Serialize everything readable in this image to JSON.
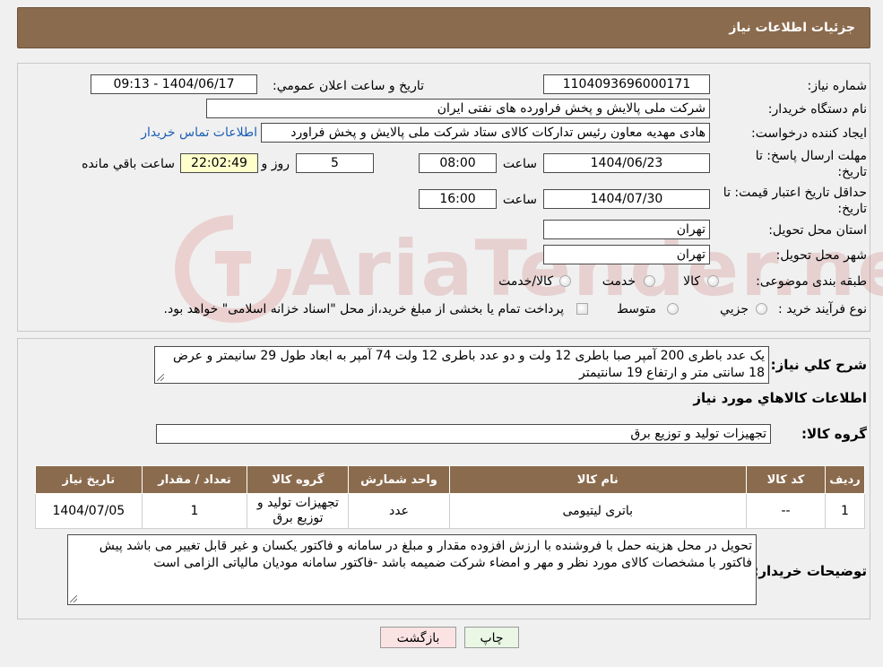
{
  "header": {
    "title": "جزئیات اطلاعات نیاز"
  },
  "form": {
    "need_number_label": "شماره نیاز:",
    "need_number": "1104093696000171",
    "announce_label": "تاریخ و ساعت اعلان عمومي:",
    "announce_value": "1404/06/17 - 09:13",
    "buyer_org_label": "نام دستگاه خریدار:",
    "buyer_org": "شرکت ملی پالایش و پخش فراورده های نفتی ایران",
    "creator_label": "ایجاد کننده درخواست:",
    "creator": "هادی مهدیه معاون رئیس تدارکات کالای ستاد شرکت ملی پالایش و پخش فراورد",
    "contact_link": "اطلاعات تماس خریدار",
    "deadline_label_1": "مهلت ارسال پاسخ: تا",
    "deadline_label_2": "تاریخ:",
    "deadline_date": "1404/06/23",
    "time_label": "ساعت",
    "deadline_time": "08:00",
    "days_value": "5",
    "days_label": "روز و",
    "remaining_time": "22:02:49",
    "remaining_label": "ساعت باقي مانده",
    "validity_label_1": "حداقل تاریخ اعتبار قیمت: تا",
    "validity_label_2": "تاریخ:",
    "validity_date": "1404/07/30",
    "validity_time": "16:00",
    "province_label": "استان محل تحویل:",
    "province": "تهران",
    "city_label": "شهر محل تحویل:",
    "city": "تهران",
    "category_label": "طبقه بندی موضوعی:",
    "category_options": [
      "کالا",
      "خدمت",
      "کالا/خدمت"
    ],
    "process_label": "نوع فرآیند خرید :",
    "process_options": [
      "جزیي",
      "متوسط"
    ],
    "process_note": "پرداخت تمام یا بخشی از مبلغ خرید،از محل \"اسناد خزانه اسلامی\" خواهد بود."
  },
  "summary": {
    "label": "شرح کلي نیاز:",
    "text": "یک عدد باطری 200 آمپر صبا باطری 12 ولت و دو عدد باطری 12 ولت 74 آمپر به ابعاد طول 29 سانیمتر و عرض 18 سانتی متر و ارتفاع 19 سانتیمتر"
  },
  "goods": {
    "section_title": "اطلاعات کالاهاي مورد نیاز",
    "group_label": "گروه کالا:",
    "group_value": "تجهیزات تولید و توزیع برق"
  },
  "table": {
    "headers": [
      "ردیف",
      "کد کالا",
      "نام کالا",
      "واحد شمارش",
      "گروه کالا",
      "تعداد / مقدار",
      "تاریخ نیاز"
    ],
    "rows": [
      [
        "1",
        "--",
        "باتری لیتیومی",
        "عدد",
        "تجهیزات تولید و توزیع برق",
        "1",
        "1404/07/05"
      ]
    ]
  },
  "buyer_notes": {
    "label": "توضیحات خریدار:",
    "text": "تحویل در محل هزینه حمل با فروشنده با ارزش افزوده مقدار و مبلغ در سامانه و فاکتور یکسان و غیر قابل تغییر می باشد پیش فاکتور با مشخصات کالای مورد نظر و مهر و امضاء شرکت ضمیمه باشد -فاکتور سامانه مودیان مالیاتی الزامی است"
  },
  "buttons": {
    "print": "چاپ",
    "back": "بازگشت"
  },
  "colors": {
    "header_bg": "#8b6b4e",
    "print_btn": "#e9f7e4",
    "back_btn": "#fbe3e3",
    "remaining_bg": "#ffffcc"
  },
  "watermark": {
    "text": "AriaTender.neT"
  }
}
